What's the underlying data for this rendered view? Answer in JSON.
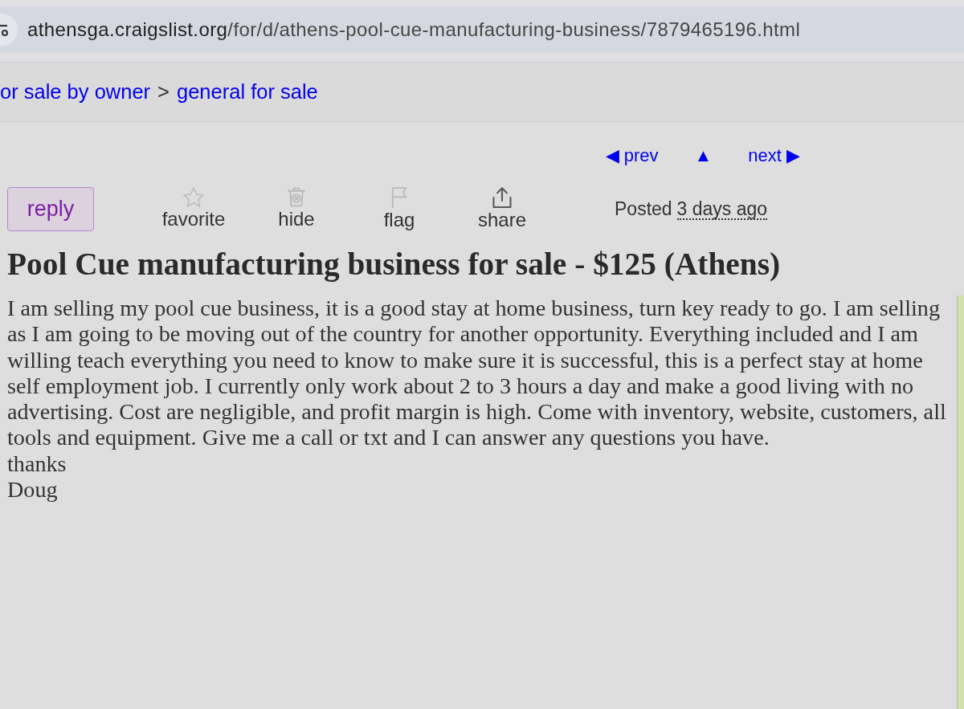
{
  "browser": {
    "url": {
      "host": "athensga.craigslist.org",
      "path": "/for/d/athens-pool-cue-manufacturing-business/7879465196.html"
    }
  },
  "breadcrumb": {
    "items": [
      {
        "label": "or sale by owner"
      },
      {
        "label": "general for sale"
      }
    ],
    "separator": ">"
  },
  "navigation": {
    "prev": "◀ prev",
    "up": "▲",
    "next": "next ▶"
  },
  "actions": {
    "reply": "reply",
    "items": [
      {
        "kind": "favorite",
        "label": "favorite"
      },
      {
        "kind": "hide",
        "label": "hide"
      },
      {
        "kind": "flag",
        "label": "flag"
      },
      {
        "kind": "share",
        "label": "share"
      }
    ]
  },
  "posted": {
    "label": "Posted",
    "time": "3 days ago"
  },
  "posting": {
    "title": "Pool Cue manufacturing business for sale - $125 (Athens)",
    "body": [
      "I am selling my pool cue business, it is a good stay at home business, turn key ready to go. I am selling as I am going to be moving out of the country for another opportunity. Everything included and I am willing teach everything you need to know to make sure it is successful, this is a perfect stay at home self employment job. I currently only work about 2 to 3 hours a day and make a good living with no advertising. Cost are negligible, and profit margin is high. Come with inventory, website, customers, all tools and equipment. Give me a call or txt and I can answer any questions you have.",
      "thanks",
      "Doug"
    ]
  }
}
